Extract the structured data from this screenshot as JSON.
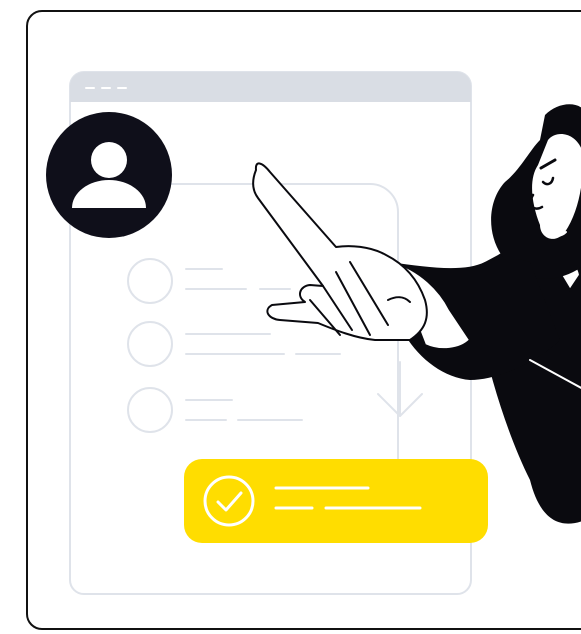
{
  "colors": {
    "outline": "#0f0f1a",
    "window_titlebar": "#d9dde4",
    "wireframe": "#dfe3ea",
    "accent_yellow": "#ffdd00",
    "skin": "#ffffff",
    "beard": "#0a0a0f"
  },
  "icons": {
    "user_avatar": "user-avatar-icon",
    "check": "check-circle-icon",
    "arrow": "arrow-down-icon"
  },
  "illustration": {
    "window_dots": 3,
    "list_rows": 3,
    "confirmation_lines": 2
  }
}
